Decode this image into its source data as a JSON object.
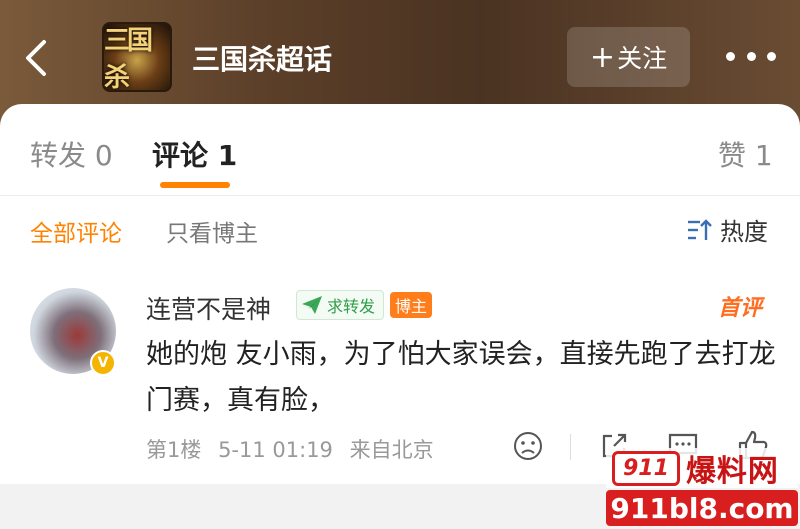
{
  "header": {
    "title": "三国杀超话",
    "logo_text": "三国杀",
    "follow_label": "关注",
    "follow_icon": "plus-icon",
    "more_icon": "more-icon",
    "back_icon": "back-icon"
  },
  "tabs": [
    {
      "label": "转发 0"
    },
    {
      "label": "评论 1"
    },
    {
      "label": "赞 1"
    }
  ],
  "filters": {
    "all": "全部评论",
    "blogger_only": "只看博主",
    "sort_label": "热度"
  },
  "comment": {
    "username": "连营不是神",
    "repost_badge": "求转发",
    "blogger_badge": "博主",
    "first_comment": "首评",
    "verified_mark": "V",
    "text": "她的炮 友小雨，为了怕大家误会，直接先跑了去打龙门赛，真有脸，",
    "floor": "第1楼",
    "time": "5-11 01:19",
    "location": "来自北京"
  },
  "watermark": {
    "top_num": "911",
    "top_text": "爆料网",
    "bottom": "911bl8.com"
  },
  "colors": {
    "accent": "#ff8200",
    "header_bg": "#5a3e28",
    "watermark_red": "#d81e1e"
  }
}
